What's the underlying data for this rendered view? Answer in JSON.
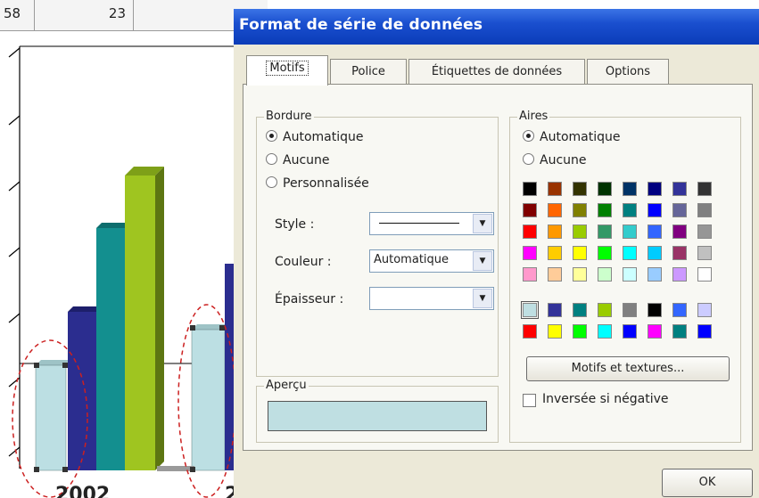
{
  "sheet": {
    "cells": [
      "58",
      "23"
    ],
    "year_label": "2002",
    "year_label_partial": "2"
  },
  "chart_data": {
    "type": "bar",
    "categories": [
      "2002",
      "2"
    ],
    "series_colors": [
      "#bcdfe3",
      "#2b2d8f",
      "#138f8f",
      "#9fc520"
    ]
  },
  "dialog": {
    "title": "Format de série de données",
    "tabs": [
      "Motifs",
      "Police",
      "Étiquettes de données",
      "Options"
    ],
    "bordure": {
      "title": "Bordure",
      "options": [
        "Automatique",
        "Aucune",
        "Personnalisée"
      ],
      "selected": "Automatique",
      "style_label": "Style :",
      "couleur_label": "Couleur :",
      "couleur_value": "Automatique",
      "epaisseur_label": "Épaisseur :"
    },
    "aires": {
      "title": "Aires",
      "options": [
        "Automatique",
        "Aucune"
      ],
      "selected": "Automatique",
      "palette": [
        [
          "#000000",
          "#993300",
          "#333300",
          "#003300",
          "#003366",
          "#000080",
          "#333399",
          "#333333"
        ],
        [
          "#800000",
          "#FF6600",
          "#808000",
          "#008000",
          "#008080",
          "#0000FF",
          "#666699",
          "#808080"
        ],
        [
          "#FF0000",
          "#FF9900",
          "#99CC00",
          "#339966",
          "#33CCCC",
          "#3366FF",
          "#800080",
          "#969696"
        ],
        [
          "#FF00FF",
          "#FFCC00",
          "#FFFF00",
          "#00FF00",
          "#00FFFF",
          "#00CCFF",
          "#993366",
          "#C0C0C0"
        ],
        [
          "#FF99CC",
          "#FFCC99",
          "#FFFF99",
          "#CCFFCC",
          "#CCFFFF",
          "#99CCFF",
          "#CC99FF",
          "#FFFFFF"
        ]
      ],
      "custom_row1": [
        "#BFDFE2",
        "#333399",
        "#008080",
        "#99CC00",
        "#808080",
        "#000000",
        "#3366FF",
        "#CCCCFF"
      ],
      "custom_row2": [
        "#FF0000",
        "#FFFF00",
        "#00FF00",
        "#00FFFF",
        "#0000FF",
        "#FF00FF",
        "#008080",
        "#0000FF"
      ],
      "motifs_button": "Motifs et textures...",
      "inverse_label": "Inversée si négative"
    },
    "apercu": {
      "title": "Aperçu",
      "color": "#BFDFE2"
    },
    "ok_label": "OK"
  }
}
